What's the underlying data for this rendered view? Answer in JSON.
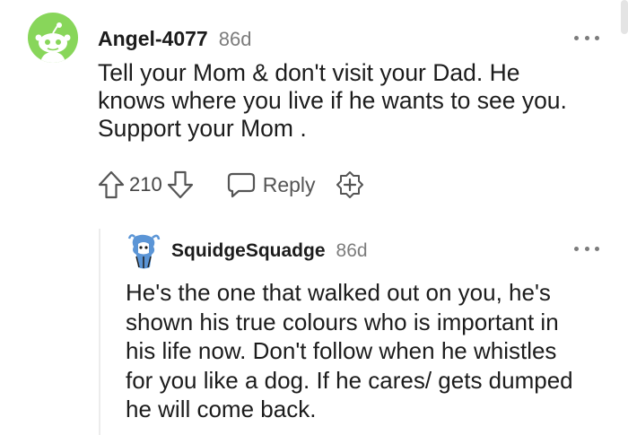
{
  "comment": {
    "author": "Angel-4077",
    "age": "86d",
    "avatar_icon": "reddit-snoo-icon",
    "avatar_color": "#88d65a",
    "body": "Tell your Mom & don't visit your Dad. He\nknows where you live if he wants to see you.\nSupport your Mom .",
    "score": "210",
    "reply_label": "Reply",
    "icons": {
      "upvote": "arrow-up-icon",
      "downvote": "arrow-down-icon",
      "reply": "speech-bubble-icon",
      "award": "award-plus-icon",
      "more": "more-options-icon"
    }
  },
  "reply": {
    "author": "SquidgeSquadge",
    "age": "86d",
    "avatar_icon": "squid-avatar-icon",
    "body": "He's the one that walked out on you, he's\nshown his true colours who is important in\nhis life now. Don't follow when he whistles\nfor you like a dog. If he cares/ gets dumped\nhe will come back."
  }
}
